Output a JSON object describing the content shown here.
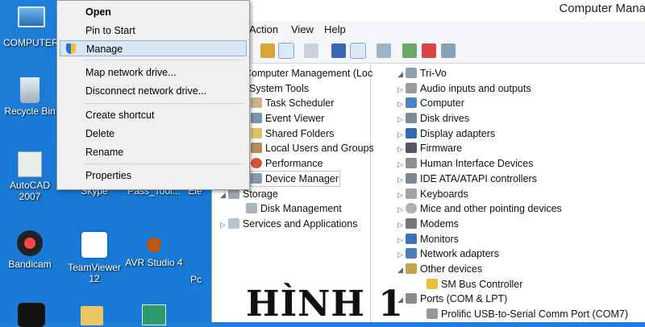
{
  "desktop": {
    "icons": [
      {
        "label": "COMPUTER"
      },
      {
        "label": "Recycle Bin"
      },
      {
        "label": "AutoCAD 2007"
      },
      {
        "label": "Skype"
      },
      {
        "label": "Pass_Tool..."
      },
      {
        "label": "Bandicam"
      },
      {
        "label": "TeamViewer 12"
      },
      {
        "label": "AVR Studio 4"
      },
      {
        "label": "Ele"
      },
      {
        "label": "Pc"
      }
    ]
  },
  "window": {
    "title": "Computer Mana",
    "menu": [
      "Action",
      "View",
      "Help"
    ],
    "tree": [
      {
        "label": "Computer Management (Local",
        "expanded": true
      },
      {
        "label": "System Tools",
        "expanded": true
      },
      {
        "label": "Task Scheduler"
      },
      {
        "label": "Event Viewer"
      },
      {
        "label": "Shared Folders"
      },
      {
        "label": "Local Users and Groups"
      },
      {
        "label": "Performance"
      },
      {
        "label": "Device Manager",
        "selected": true
      },
      {
        "label": "Storage",
        "expanded": true
      },
      {
        "label": "Disk Management"
      },
      {
        "label": "Services and Applications"
      }
    ],
    "devices": [
      {
        "label": "Tri-Vo",
        "expanded": true
      },
      {
        "label": "Audio inputs and outputs"
      },
      {
        "label": "Computer"
      },
      {
        "label": "Disk drives"
      },
      {
        "label": "Display adapters"
      },
      {
        "label": "Firmware"
      },
      {
        "label": "Human Interface Devices"
      },
      {
        "label": "IDE ATA/ATAPI controllers"
      },
      {
        "label": "Keyboards"
      },
      {
        "label": "Mice and other pointing devices"
      },
      {
        "label": "Modems"
      },
      {
        "label": "Monitors"
      },
      {
        "label": "Network adapters"
      },
      {
        "label": "Other devices",
        "expanded": true
      },
      {
        "label": "SM Bus Controller"
      },
      {
        "label": "Ports (COM & LPT)",
        "expanded": true
      },
      {
        "label": "Prolific USB-to-Serial Comm Port (COM7)"
      }
    ]
  },
  "context_menu": {
    "items": [
      {
        "label": "Open"
      },
      {
        "label": "Pin to Start"
      },
      {
        "label": "Manage",
        "highlighted": true
      },
      {
        "label": "Map network drive..."
      },
      {
        "label": "Disconnect network drive..."
      },
      {
        "label": "Create shortcut"
      },
      {
        "label": "Delete"
      },
      {
        "label": "Rename"
      },
      {
        "label": "Properties"
      }
    ]
  },
  "watermark": "HÌNH 1",
  "colors": {
    "desktop": "#1e7fd8",
    "menu_highlight": "#d8e6f3",
    "menu_bg": "#f0f0f0"
  }
}
